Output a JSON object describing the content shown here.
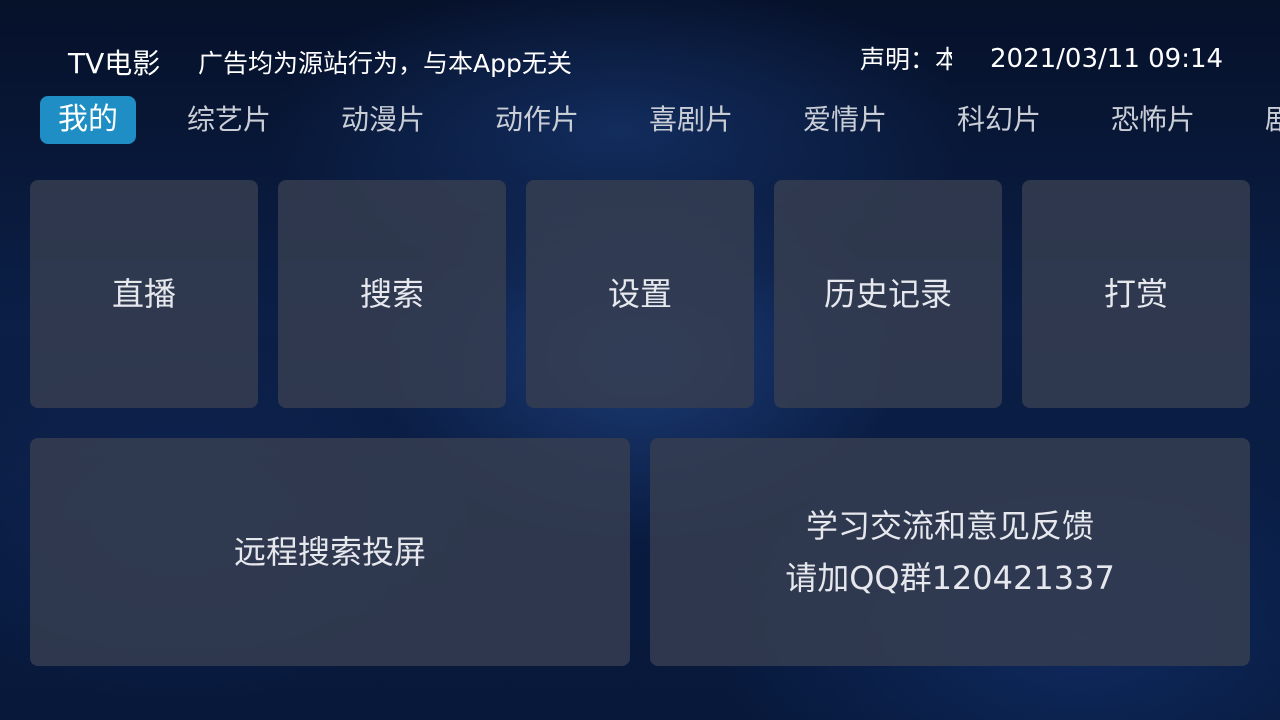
{
  "header": {
    "app_title": "TV电影",
    "notice": "广告均为源站行为，与本App无关",
    "statement": "声明：本",
    "datetime": "2021/03/11 09:14"
  },
  "tabs": [
    {
      "label": "我的",
      "active": true
    },
    {
      "label": "综艺片",
      "active": false
    },
    {
      "label": "动漫片",
      "active": false
    },
    {
      "label": "动作片",
      "active": false
    },
    {
      "label": "喜剧片",
      "active": false
    },
    {
      "label": "爱情片",
      "active": false
    },
    {
      "label": "科幻片",
      "active": false
    },
    {
      "label": "恐怖片",
      "active": false
    },
    {
      "label": "剧",
      "active": false
    }
  ],
  "tiles": {
    "live": "直播",
    "search": "搜索",
    "settings": "设置",
    "history": "历史记录",
    "reward": "打赏",
    "remote_cast": "远程搜索投屏",
    "feedback_line1": "学习交流和意见反馈",
    "feedback_line2": "请加QQ群120421337"
  },
  "colors": {
    "active_tab": "#1f8ec4",
    "tile_bg": "#373e50",
    "background": "#0b1f47"
  }
}
